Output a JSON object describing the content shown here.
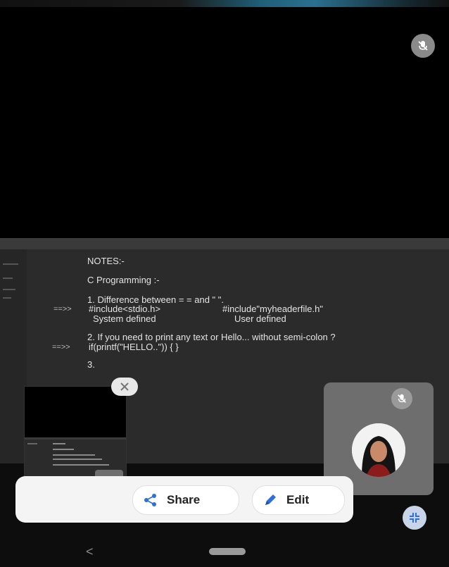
{
  "notes": {
    "heading": "NOTES:-",
    "topic": "C Programming :-",
    "q1": "1. Difference between = = and \" \".",
    "arrow1": "==>>",
    "q1_left": "#include<stdio.h>",
    "q1_right": "#include\"myheaderfile.h\"",
    "q1_left_desc": "System defined",
    "q1_right_desc": "User defined",
    "q2": "2. If you need to print any text or Hello... without semi-colon ?",
    "arrow2": "==>>",
    "q2_answer": "if(printf(\"HELLO..\")) { }",
    "q3": "3."
  },
  "actions": {
    "share_label": "Share",
    "edit_label": "Edit"
  },
  "icons": {
    "mic_off": "mic-off-icon",
    "close": "close-icon",
    "share": "share-icon",
    "edit": "pencil-icon",
    "shrink": "shrink-icon",
    "back": "back-icon",
    "home": "home-icon"
  },
  "colors": {
    "accent": "#2f6fdc",
    "notes_bg": "#2b2b2b",
    "bar_bg": "#f4f4f4"
  }
}
